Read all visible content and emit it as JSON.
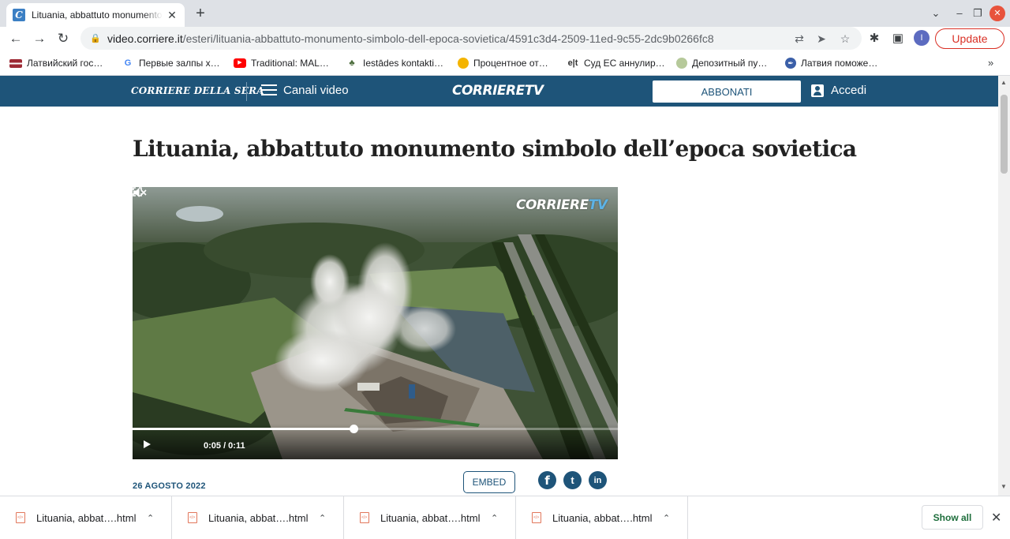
{
  "browser": {
    "tab": {
      "title": "Lituania, abbattuto monumento simbolo dell'epoca sovietica",
      "favicon_letter": "C",
      "close": "✕"
    },
    "new_tab": "+",
    "window_controls": {
      "dropdown": "⌄",
      "minimize": "–",
      "restore": "❐",
      "close": "✕"
    },
    "nav": {
      "back": "←",
      "forward": "→",
      "reload": "↻"
    },
    "url": {
      "host": "video.corriere.it",
      "path": "/esteri/lituania-abbattuto-monumento-simbolo-dell-epoca-sovietica/4591c3d4-2509-11ed-9c55-2dc9b0266fc8"
    },
    "profile_initial": "I",
    "update_label": "Update",
    "bookmarks": [
      {
        "label": "Латвийский гос…",
        "icon": "latvia-flag-icon"
      },
      {
        "label": "Первые залпы х…",
        "icon": "google-icon"
      },
      {
        "label": "Traditional: MAL…",
        "icon": "youtube-icon"
      },
      {
        "label": "Iestādes kontakti…",
        "icon": "tree-icon"
      },
      {
        "label": "Процентное от…",
        "icon": "coin-icon"
      },
      {
        "label": "Суд ЕС аннулир…",
        "icon": "delfi-icon"
      },
      {
        "label": "Депозитный пу…",
        "icon": "leaf-icon"
      },
      {
        "label": "Латвия поможе…",
        "icon": "feather-icon"
      }
    ],
    "bookmarks_more": "»"
  },
  "site_header": {
    "logo_left": "CORRIERE DELLA SERA",
    "menu_label": "Canali video",
    "logo_center": "CORRIERETV",
    "subscribe_label": "ABBONATI",
    "login_label": "Accedi",
    "color": "#1e5479"
  },
  "article": {
    "headline": "Lituania, abbattuto monumento simbolo dell’epoca sovietica",
    "date": "26 AGOSTO 2022",
    "embed_label": "EMBED",
    "social": {
      "facebook": "f",
      "twitter": "t",
      "linkedin": "in"
    }
  },
  "video": {
    "watermark_main": "CORRIERE",
    "watermark_tv": "TV",
    "time": "0:05 / 0:11",
    "progress": 0.4545
  },
  "downloads": {
    "items": [
      {
        "name": "Lituania, abbat….html"
      },
      {
        "name": "Lituania, abbat….html"
      },
      {
        "name": "Lituania, abbat….html"
      },
      {
        "name": "Lituania, abbat….html"
      }
    ],
    "show_all_label": "Show all",
    "close": "✕"
  }
}
